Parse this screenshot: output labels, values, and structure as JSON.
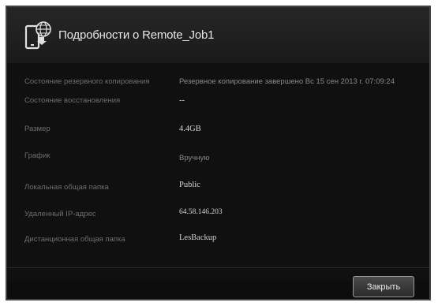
{
  "dialog": {
    "title": "Подробности о Remote_Job1",
    "icon": "phone-cloud-icon",
    "close_label": "Закрыть"
  },
  "details": [
    {
      "label": "Состояние резервного копирования",
      "value": "Резервное копирование завершено Вс 15 сен 2013 г. 07:09:24"
    },
    {
      "label": "Состояние восстановления",
      "value": "--"
    },
    {
      "label": "Размер",
      "value": "4.4GB"
    },
    {
      "label": "График",
      "value": "Вручную"
    },
    {
      "label": "Локальная общая папка",
      "value": "Public"
    },
    {
      "label": "Удаленный IP-адрес",
      "value": "64.58.146.203"
    },
    {
      "label": "Дистанционная общая папка",
      "value": "LesBackup"
    }
  ]
}
